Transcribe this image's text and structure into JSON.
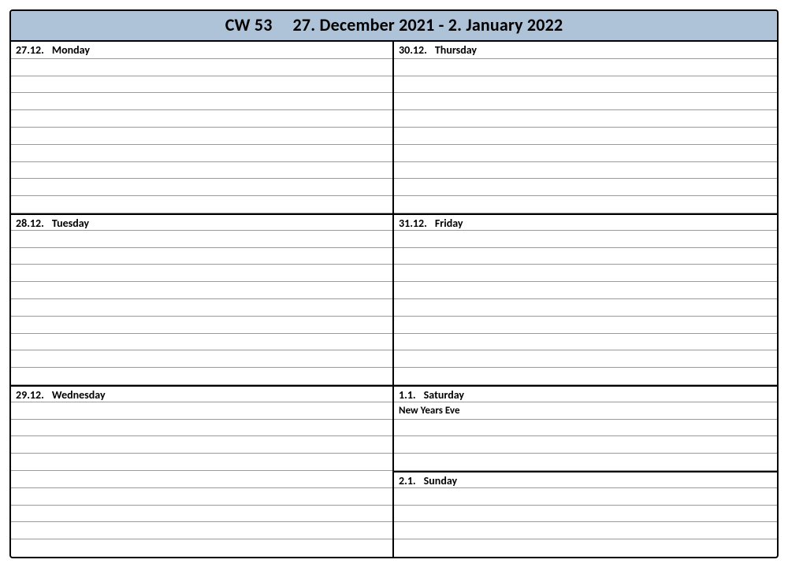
{
  "header": {
    "week_label": "CW 53",
    "range": "27. December 2021 - 2. January 2022"
  },
  "left_days": [
    {
      "date": "27.12.",
      "weekday": "Monday",
      "rows": 10,
      "sep": " "
    },
    {
      "date": "28.12.",
      "weekday": "Tuesday",
      "rows": 10,
      "sep": "   "
    },
    {
      "date": "29.12.",
      "weekday": "Wednesday",
      "rows": 10,
      "sep": "   "
    }
  ],
  "right_days": [
    {
      "date": "30.12.",
      "weekday": "Thursday",
      "rows": 10,
      "sep": "   "
    },
    {
      "date": "31.12.",
      "weekday": "Friday",
      "rows": 10,
      "sep": "   "
    },
    {
      "date": "1.1.",
      "weekday": "Saturday",
      "rows": 5,
      "sep": "   ",
      "notes": [
        "New Years Eve"
      ]
    },
    {
      "date": "2.1.",
      "weekday": "Sunday",
      "rows": 5,
      "sep": "   "
    }
  ]
}
